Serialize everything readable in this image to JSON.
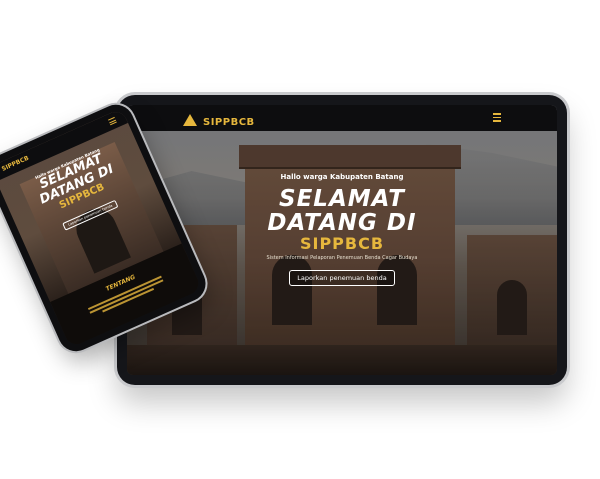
{
  "brand": {
    "name": "SIPPBCB",
    "color_accent": "#e6b73d",
    "color_nav": "#0d0d0f"
  },
  "hero": {
    "greeting": "Hallo warga Kabupaten Batang",
    "title_line1": "SELAMAT",
    "title_line2": "DATANG DI",
    "title_line3": "SIPPBCB",
    "subtitle": "Sistem Informasi Pelaporan Penemuan Benda Cagar Budaya",
    "cta_label": "Laporkan penemuan benda"
  },
  "phone": {
    "section_title": "TENTANG"
  },
  "icons": {
    "logo": "pyramid-logo-icon",
    "menu": "hamburger-menu-icon"
  }
}
